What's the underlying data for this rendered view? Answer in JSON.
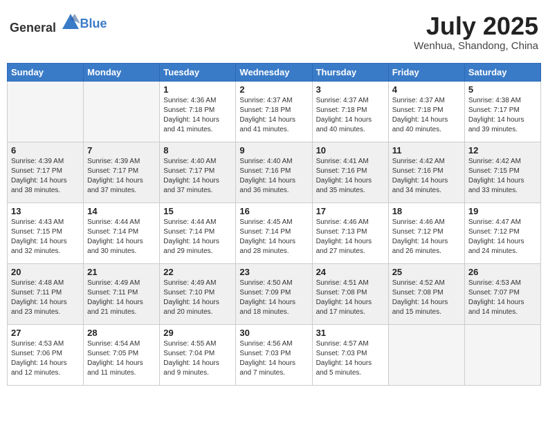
{
  "header": {
    "logo_general": "General",
    "logo_blue": "Blue",
    "month_title": "July 2025",
    "subtitle": "Wenhua, Shandong, China"
  },
  "days_of_week": [
    "Sunday",
    "Monday",
    "Tuesday",
    "Wednesday",
    "Thursday",
    "Friday",
    "Saturday"
  ],
  "weeks": [
    [
      {
        "day": "",
        "empty": true
      },
      {
        "day": "",
        "empty": true
      },
      {
        "day": "1",
        "rise": "Sunrise: 4:36 AM",
        "set": "Sunset: 7:18 PM",
        "daylight": "Daylight: 14 hours and 41 minutes."
      },
      {
        "day": "2",
        "rise": "Sunrise: 4:37 AM",
        "set": "Sunset: 7:18 PM",
        "daylight": "Daylight: 14 hours and 41 minutes."
      },
      {
        "day": "3",
        "rise": "Sunrise: 4:37 AM",
        "set": "Sunset: 7:18 PM",
        "daylight": "Daylight: 14 hours and 40 minutes."
      },
      {
        "day": "4",
        "rise": "Sunrise: 4:37 AM",
        "set": "Sunset: 7:18 PM",
        "daylight": "Daylight: 14 hours and 40 minutes."
      },
      {
        "day": "5",
        "rise": "Sunrise: 4:38 AM",
        "set": "Sunset: 7:17 PM",
        "daylight": "Daylight: 14 hours and 39 minutes."
      }
    ],
    [
      {
        "day": "6",
        "rise": "Sunrise: 4:39 AM",
        "set": "Sunset: 7:17 PM",
        "daylight": "Daylight: 14 hours and 38 minutes."
      },
      {
        "day": "7",
        "rise": "Sunrise: 4:39 AM",
        "set": "Sunset: 7:17 PM",
        "daylight": "Daylight: 14 hours and 37 minutes."
      },
      {
        "day": "8",
        "rise": "Sunrise: 4:40 AM",
        "set": "Sunset: 7:17 PM",
        "daylight": "Daylight: 14 hours and 37 minutes."
      },
      {
        "day": "9",
        "rise": "Sunrise: 4:40 AM",
        "set": "Sunset: 7:16 PM",
        "daylight": "Daylight: 14 hours and 36 minutes."
      },
      {
        "day": "10",
        "rise": "Sunrise: 4:41 AM",
        "set": "Sunset: 7:16 PM",
        "daylight": "Daylight: 14 hours and 35 minutes."
      },
      {
        "day": "11",
        "rise": "Sunrise: 4:42 AM",
        "set": "Sunset: 7:16 PM",
        "daylight": "Daylight: 14 hours and 34 minutes."
      },
      {
        "day": "12",
        "rise": "Sunrise: 4:42 AM",
        "set": "Sunset: 7:15 PM",
        "daylight": "Daylight: 14 hours and 33 minutes."
      }
    ],
    [
      {
        "day": "13",
        "rise": "Sunrise: 4:43 AM",
        "set": "Sunset: 7:15 PM",
        "daylight": "Daylight: 14 hours and 32 minutes."
      },
      {
        "day": "14",
        "rise": "Sunrise: 4:44 AM",
        "set": "Sunset: 7:14 PM",
        "daylight": "Daylight: 14 hours and 30 minutes."
      },
      {
        "day": "15",
        "rise": "Sunrise: 4:44 AM",
        "set": "Sunset: 7:14 PM",
        "daylight": "Daylight: 14 hours and 29 minutes."
      },
      {
        "day": "16",
        "rise": "Sunrise: 4:45 AM",
        "set": "Sunset: 7:14 PM",
        "daylight": "Daylight: 14 hours and 28 minutes."
      },
      {
        "day": "17",
        "rise": "Sunrise: 4:46 AM",
        "set": "Sunset: 7:13 PM",
        "daylight": "Daylight: 14 hours and 27 minutes."
      },
      {
        "day": "18",
        "rise": "Sunrise: 4:46 AM",
        "set": "Sunset: 7:12 PM",
        "daylight": "Daylight: 14 hours and 26 minutes."
      },
      {
        "day": "19",
        "rise": "Sunrise: 4:47 AM",
        "set": "Sunset: 7:12 PM",
        "daylight": "Daylight: 14 hours and 24 minutes."
      }
    ],
    [
      {
        "day": "20",
        "rise": "Sunrise: 4:48 AM",
        "set": "Sunset: 7:11 PM",
        "daylight": "Daylight: 14 hours and 23 minutes."
      },
      {
        "day": "21",
        "rise": "Sunrise: 4:49 AM",
        "set": "Sunset: 7:11 PM",
        "daylight": "Daylight: 14 hours and 21 minutes."
      },
      {
        "day": "22",
        "rise": "Sunrise: 4:49 AM",
        "set": "Sunset: 7:10 PM",
        "daylight": "Daylight: 14 hours and 20 minutes."
      },
      {
        "day": "23",
        "rise": "Sunrise: 4:50 AM",
        "set": "Sunset: 7:09 PM",
        "daylight": "Daylight: 14 hours and 18 minutes."
      },
      {
        "day": "24",
        "rise": "Sunrise: 4:51 AM",
        "set": "Sunset: 7:08 PM",
        "daylight": "Daylight: 14 hours and 17 minutes."
      },
      {
        "day": "25",
        "rise": "Sunrise: 4:52 AM",
        "set": "Sunset: 7:08 PM",
        "daylight": "Daylight: 14 hours and 15 minutes."
      },
      {
        "day": "26",
        "rise": "Sunrise: 4:53 AM",
        "set": "Sunset: 7:07 PM",
        "daylight": "Daylight: 14 hours and 14 minutes."
      }
    ],
    [
      {
        "day": "27",
        "rise": "Sunrise: 4:53 AM",
        "set": "Sunset: 7:06 PM",
        "daylight": "Daylight: 14 hours and 12 minutes."
      },
      {
        "day": "28",
        "rise": "Sunrise: 4:54 AM",
        "set": "Sunset: 7:05 PM",
        "daylight": "Daylight: 14 hours and 11 minutes."
      },
      {
        "day": "29",
        "rise": "Sunrise: 4:55 AM",
        "set": "Sunset: 7:04 PM",
        "daylight": "Daylight: 14 hours and 9 minutes."
      },
      {
        "day": "30",
        "rise": "Sunrise: 4:56 AM",
        "set": "Sunset: 7:03 PM",
        "daylight": "Daylight: 14 hours and 7 minutes."
      },
      {
        "day": "31",
        "rise": "Sunrise: 4:57 AM",
        "set": "Sunset: 7:03 PM",
        "daylight": "Daylight: 14 hours and 5 minutes."
      },
      {
        "day": "",
        "empty": true
      },
      {
        "day": "",
        "empty": true
      }
    ]
  ]
}
